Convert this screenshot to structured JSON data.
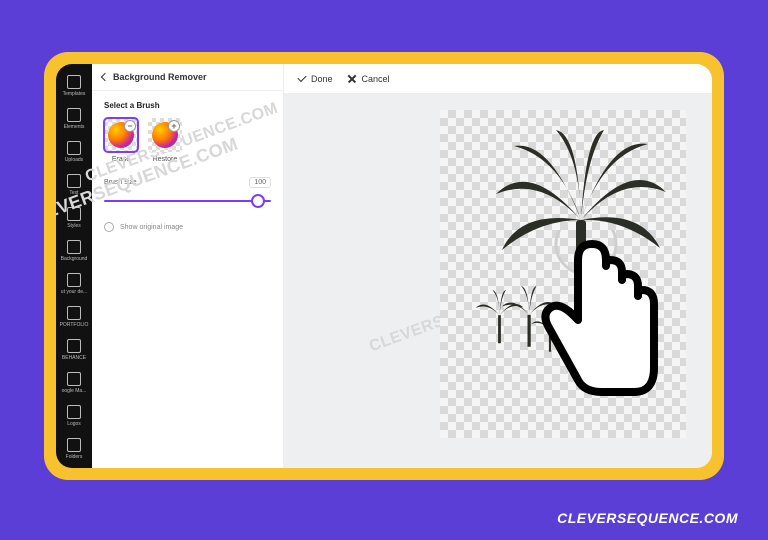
{
  "sidebar": {
    "items": [
      {
        "label": "Templates"
      },
      {
        "label": "Elements"
      },
      {
        "label": "Uploads"
      },
      {
        "label": "Text"
      },
      {
        "label": "Styles"
      },
      {
        "label": "Background"
      },
      {
        "label": "ut your de..."
      },
      {
        "label": "PORTFOLIO"
      },
      {
        "label": "BEHANCE"
      },
      {
        "label": "oogle Ma..."
      },
      {
        "label": "Logos"
      },
      {
        "label": "Folders"
      }
    ]
  },
  "panel": {
    "title": "Background Remover",
    "section_title": "Select a Brush",
    "erase_label": "Erase",
    "restore_label": "Restore",
    "brush_size_label": "Brush size",
    "brush_size_value": "100",
    "show_original_label": "Show original image"
  },
  "topbar": {
    "done_label": "Done",
    "cancel_label": "Cancel"
  },
  "slider": {
    "percent": 92
  },
  "watermark": "CLEVERSEQUENCE.COM",
  "attribution": "CLEVERSEQUENCE.COM"
}
